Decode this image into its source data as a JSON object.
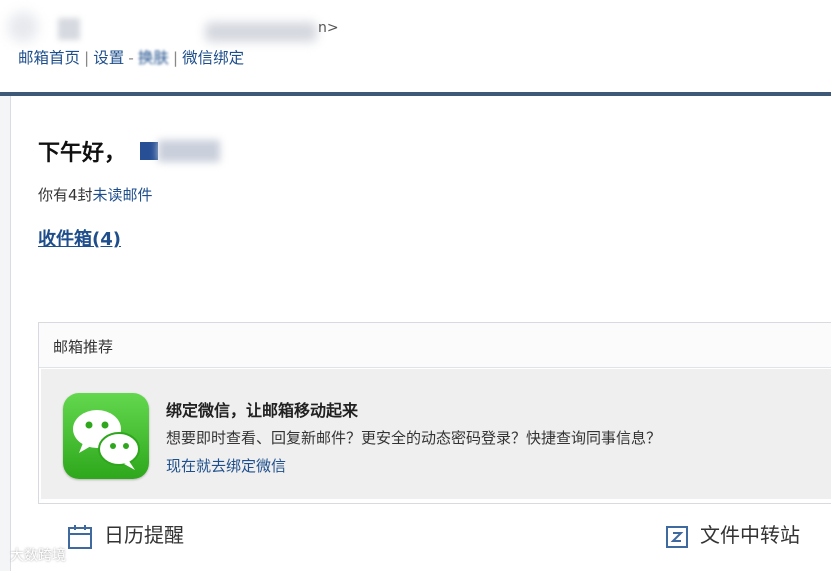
{
  "header": {
    "account_tail": "n>",
    "nav": [
      {
        "label": "邮箱首页"
      },
      {
        "label": "设置"
      },
      {
        "label": "换肤"
      },
      {
        "label": "微信绑定"
      }
    ]
  },
  "main": {
    "greeting": "下午好，",
    "unread_prefix": "你有4封",
    "unread_link": "未读邮件",
    "inbox_link": "收件箱(4)"
  },
  "recommend": {
    "title": "邮箱推荐",
    "heading": "绑定微信，让邮箱移动起来",
    "description": "想要即时查看、回复新邮件？更安全的动态密码登录？快捷查询同事信息？",
    "link": "现在就去绑定微信",
    "icon": "wechat-icon"
  },
  "tools": {
    "calendar_label": "日历提醒",
    "calendar_icon": "calendar-icon",
    "file_label": "文件中转站",
    "file_icon": "file-transfer-icon"
  },
  "watermark": "大数跨境",
  "colors": {
    "link": "#1e4f8c",
    "top_bar": "#3e5878",
    "wechat_green": "#3cbd2a"
  }
}
